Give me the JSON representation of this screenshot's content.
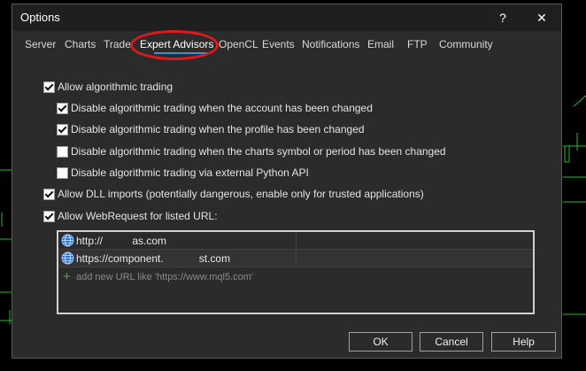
{
  "dialog": {
    "title": "Options",
    "help_glyph": "?",
    "close_glyph": "✕"
  },
  "tabs": [
    {
      "label": "Server"
    },
    {
      "label": "Charts"
    },
    {
      "label": "Trade"
    },
    {
      "label": "Expert Advisors",
      "active": true
    },
    {
      "label": "OpenCL"
    },
    {
      "label": "Events"
    },
    {
      "label": "Notifications"
    },
    {
      "label": "Email"
    },
    {
      "label": "FTP"
    },
    {
      "label": "Community"
    }
  ],
  "options": {
    "allow_algo": {
      "label": "Allow algorithmic trading",
      "checked": true
    },
    "disable_account": {
      "label": "Disable algorithmic trading when the account has been changed",
      "checked": true
    },
    "disable_profile": {
      "label": "Disable algorithmic trading when the profile has been changed",
      "checked": true
    },
    "disable_symbol": {
      "label": "Disable algorithmic trading when the charts symbol or period has been changed",
      "checked": false
    },
    "disable_python": {
      "label": "Disable algorithmic trading via external Python API",
      "checked": false
    },
    "allow_dll": {
      "label": "Allow DLL imports (potentially dangerous, enable only for trusted applications)",
      "checked": true
    },
    "allow_webrequest": {
      "label": "Allow WebRequest for listed URL:",
      "checked": true
    }
  },
  "url_list": {
    "rows": [
      {
        "text": "http://          as.com"
      },
      {
        "text": "https://component.            st.com"
      }
    ],
    "add_placeholder": "add new URL like 'https://www.mql5.com'"
  },
  "buttons": {
    "ok": "OK",
    "cancel": "Cancel",
    "help": "Help"
  },
  "colors": {
    "accent": "#3c8ed9",
    "annotation": "#e0191e",
    "chart_line": "#22c022",
    "add_icon": "#3db83d"
  }
}
